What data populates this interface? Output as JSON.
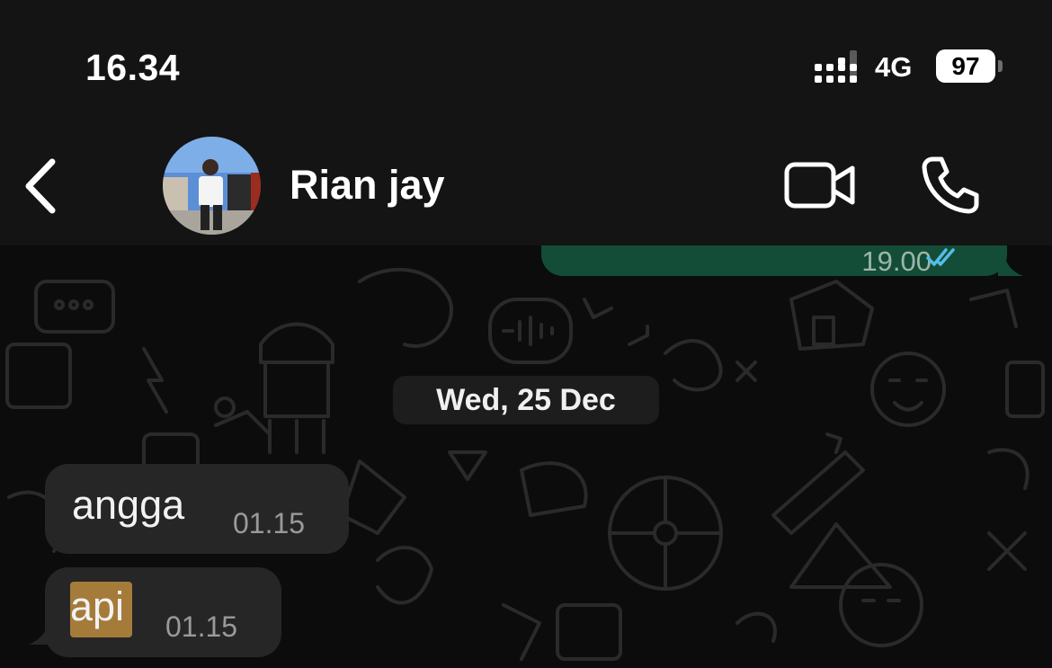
{
  "status_bar": {
    "time": "16.34",
    "network": "4G",
    "battery": "97"
  },
  "header": {
    "contact_name": "Rian jay",
    "icons": [
      "back-chevron-icon",
      "avatar",
      "video-camera-icon",
      "phone-icon"
    ]
  },
  "chat": {
    "outgoing_partial": {
      "time": "19.00",
      "status_icon": "double-check-read-icon",
      "status_color": "#53bdeb"
    },
    "date_separator": "Wed, 25 Dec",
    "messages": [
      {
        "text": "angga",
        "time": "01.15"
      },
      {
        "text": "api",
        "time": "01.15"
      }
    ]
  },
  "colors": {
    "header_bg": "#141414",
    "chat_bg": "#0c0c0c",
    "outgoing_bubble": "#134d37",
    "incoming_bubble": "#262626",
    "text_highlight": "#a57b3a"
  }
}
